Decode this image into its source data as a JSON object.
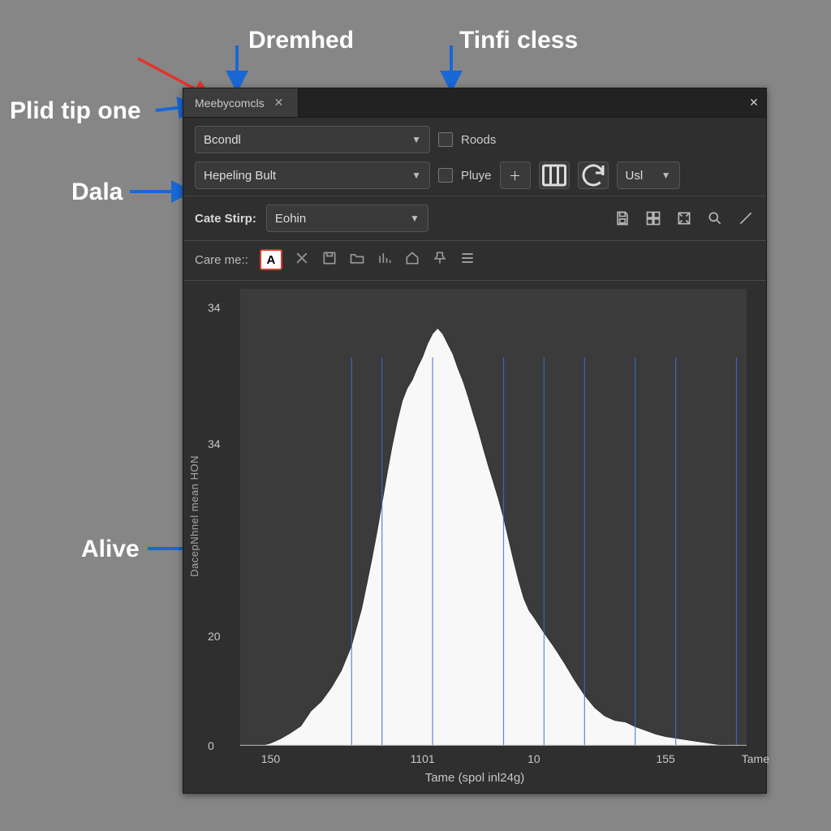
{
  "callouts": {
    "plid": "Plid tip one",
    "dremhed": "Dremhed",
    "tinfi": "Tinfi cless",
    "dala": "Dala",
    "alive": "Alive"
  },
  "panel": {
    "tab_label": "Meebycomcls"
  },
  "row1": {
    "select_value": "Bcondl",
    "check_label": "Roods"
  },
  "row2": {
    "select_value": "Hepeling Bult",
    "check_label": "Pluye",
    "usl": "Usl"
  },
  "toolbar2": {
    "label": "Cate Stirp:",
    "select_value": "Eohin"
  },
  "toolbar3": {
    "label": "Care me::",
    "swatch": "A"
  },
  "chart_data": {
    "type": "bar",
    "xlabel": "Tame (spol inl24g)",
    "ylabel": "DacepNhnel mean HON",
    "x_ticks": [
      "150",
      "1101",
      "10",
      "155"
    ],
    "x_ticks_pos_pct": [
      6,
      36,
      58,
      84
    ],
    "x_right_label": "Tame",
    "y_ticks": [
      "0",
      "20",
      "34",
      "34"
    ],
    "y_ticks_pos_pct": [
      100,
      76,
      34,
      4
    ],
    "ylim": [
      0,
      36
    ],
    "x": [
      0,
      2,
      4,
      6,
      8,
      10,
      12,
      14,
      16,
      18,
      20,
      22,
      23,
      24,
      25,
      26,
      27,
      28,
      29,
      30,
      31,
      32,
      33,
      34,
      35,
      36,
      37,
      38,
      39,
      40,
      41,
      42,
      43,
      44,
      45,
      46,
      47,
      48,
      49,
      50,
      51,
      52,
      53,
      54,
      55,
      56,
      57,
      58,
      60,
      62,
      64,
      66,
      68,
      70,
      72,
      74,
      76,
      78,
      80,
      82,
      84,
      86,
      88,
      90,
      92,
      94,
      96,
      98,
      100
    ],
    "values": [
      0,
      0,
      0,
      0.3,
      0.6,
      1,
      1.5,
      2.3,
      3.2,
      4.5,
      6,
      8,
      9.5,
      11,
      13,
      15,
      17,
      19,
      21,
      23,
      25,
      27,
      28.5,
      29.5,
      30.5,
      31,
      31.6,
      32,
      32.3,
      32,
      31.5,
      31,
      30,
      29,
      27.7,
      26.3,
      25,
      23.5,
      22,
      20.5,
      19,
      17.5,
      16,
      14.7,
      13.5,
      12.3,
      11.2,
      10.2,
      8.5,
      7.1,
      5.9,
      4.9,
      4.1,
      3.4,
      2.8,
      2.3,
      1.9,
      1.5,
      1.2,
      0.9,
      0.7,
      0.55,
      0.42,
      0.32,
      0.24,
      0.18,
      0.12,
      0.07,
      0.03
    ],
    "blue_lines_pct": [
      22,
      28,
      38,
      52,
      60,
      68,
      78,
      86,
      98
    ]
  }
}
